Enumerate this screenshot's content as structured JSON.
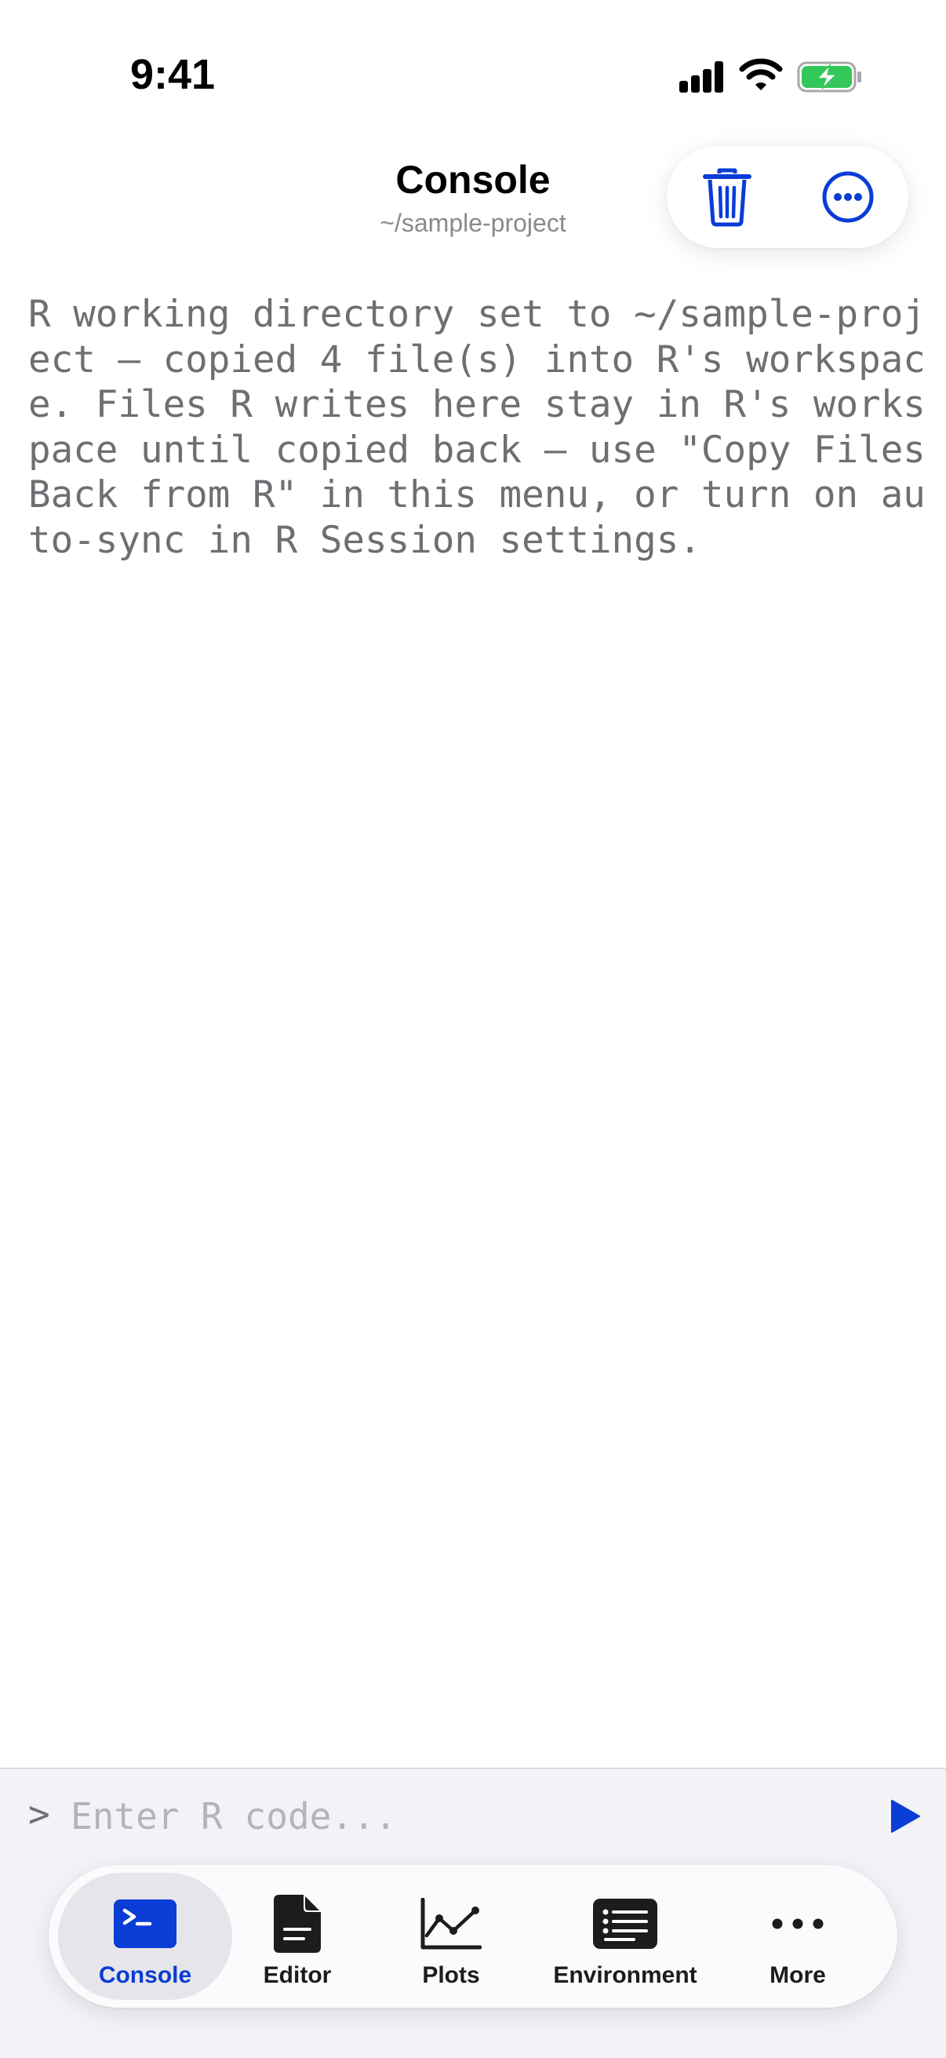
{
  "status_bar": {
    "time": "9:41"
  },
  "header": {
    "title": "Console",
    "subtitle": "~/sample-project"
  },
  "actions": {
    "trash_icon": "trash-icon",
    "more_icon": "ellipsis-circle-icon"
  },
  "console": {
    "output": "R working directory set to ~/sample-project — copied 4 file(s) into R's workspace. Files R writes here stay in R's workspace until copied back — use \"Copy Files Back from R\" in this menu, or turn on auto-sync in R Session settings."
  },
  "input": {
    "prompt": ">",
    "placeholder": "Enter R code...",
    "value": ""
  },
  "tabs": [
    {
      "label": "Console",
      "icon": "terminal-icon",
      "active": true
    },
    {
      "label": "Editor",
      "icon": "document-icon",
      "active": false
    },
    {
      "label": "Plots",
      "icon": "line-chart-icon",
      "active": false
    },
    {
      "label": "Environment",
      "icon": "list-icon",
      "active": false
    },
    {
      "label": "More",
      "icon": "ellipsis-icon",
      "active": false
    }
  ],
  "colors": {
    "accent": "#0a3cd6",
    "battery_fill": "#34c759",
    "output_text": "#6e6e73",
    "input_background": "#f2f2f7"
  }
}
